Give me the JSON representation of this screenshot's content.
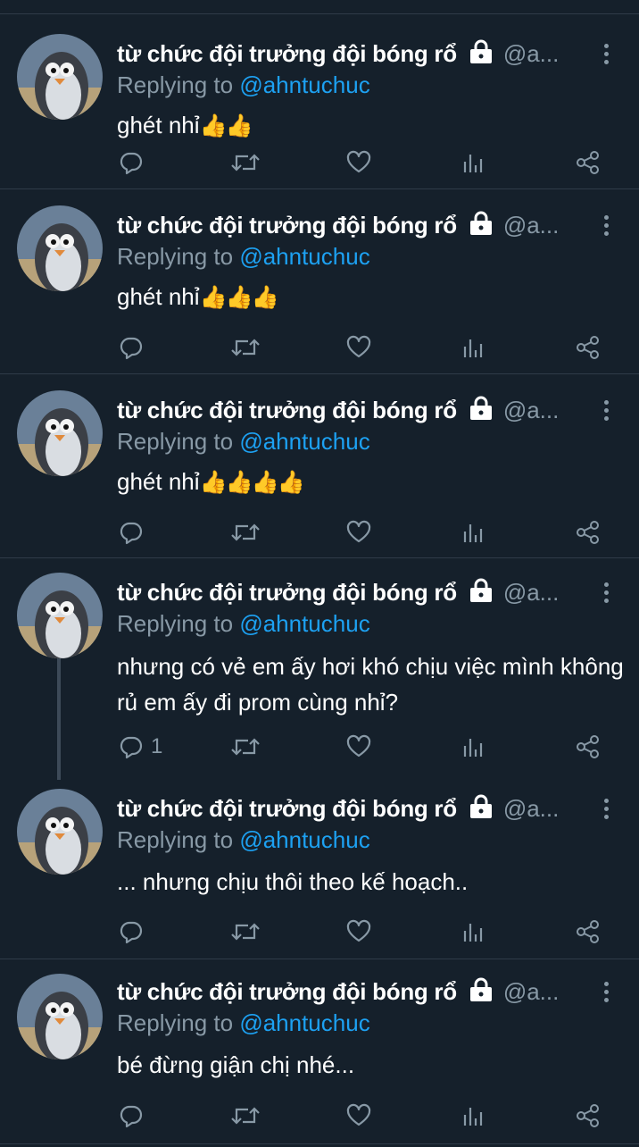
{
  "icons": {
    "reply": "reply-icon",
    "retweet": "retweet-icon",
    "like": "heart-icon",
    "analytics": "analytics-icon",
    "share": "share-icon",
    "lock": "lock-icon",
    "more": "more-vertical-icon"
  },
  "colors": {
    "background": "#15202b",
    "secondary_text": "#8899a6",
    "link": "#1da1f2",
    "divider": "#2f3b48"
  },
  "tweets": [
    {
      "name": "từ chức đội trưởng đội bóng rổ",
      "handle": "@a...",
      "replying_label": "Replying to",
      "mention": "@ahntuchuc",
      "text": "ghét nhỉ",
      "emoji": "👍👍",
      "reply_count": ""
    },
    {
      "name": "từ chức đội trưởng đội bóng rổ",
      "handle": "@a...",
      "replying_label": "Replying to",
      "mention": "@ahntuchuc",
      "text": "ghét nhỉ",
      "emoji": "👍👍👍",
      "reply_count": ""
    },
    {
      "name": "từ chức đội trưởng đội bóng rổ",
      "handle": "@a...",
      "replying_label": "Replying to",
      "mention": "@ahntuchuc",
      "text": "ghét nhỉ",
      "emoji": "👍👍👍👍",
      "reply_count": ""
    },
    {
      "name": "từ chức đội trưởng đội bóng rổ",
      "handle": "@a...",
      "replying_label": "Replying to",
      "mention": "@ahntuchuc",
      "text": "nhưng có vẻ em ấy hơi khó chịu việc mình không rủ em ấy đi prom cùng nhỉ?",
      "emoji": "",
      "reply_count": "1"
    },
    {
      "name": "từ chức đội trưởng đội bóng rổ",
      "handle": "@a...",
      "replying_label": "Replying to",
      "mention": "@ahntuchuc",
      "text": "... nhưng chịu thôi theo kế hoạch..",
      "emoji": "",
      "reply_count": ""
    },
    {
      "name": "từ chức đội trưởng đội bóng rổ",
      "handle": "@a...",
      "replying_label": "Replying to",
      "mention": "@ahntuchuc",
      "text": "bé đừng giận chị nhé...",
      "emoji": "",
      "reply_count": ""
    }
  ]
}
